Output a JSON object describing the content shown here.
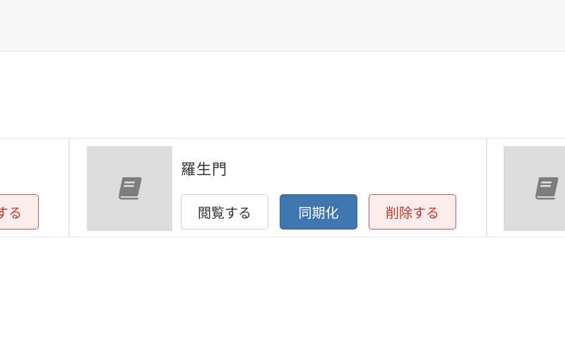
{
  "items": [
    {
      "title": "",
      "delete_label": "削除する"
    },
    {
      "title": "羅生門",
      "view_label": "閲覧する",
      "sync_label": "同期化",
      "delete_label": "削除する"
    },
    {
      "title": ""
    }
  ],
  "icons": {
    "thumbnail": "book-icon"
  },
  "colors": {
    "sync_button": "#3f76b0",
    "delete_text": "#c0392b",
    "delete_bg": "#fcecec",
    "thumbnail_bg": "#dcdcdc"
  }
}
